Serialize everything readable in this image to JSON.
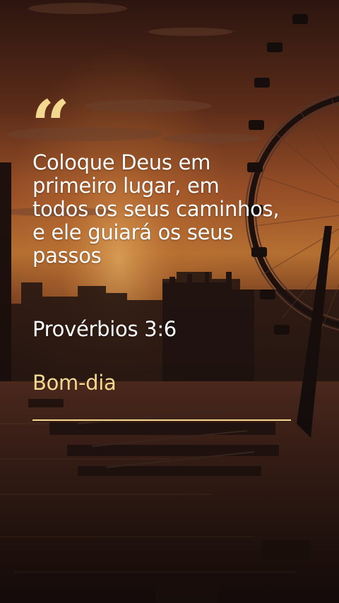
{
  "quote": {
    "mark": "“",
    "lines": [
      "Coloque Deus em",
      "primeiro lugar, em",
      "todos os seus caminhos,",
      "e ele guiará os seus",
      "passos"
    ]
  },
  "reference": "Provérbios 3:6",
  "greeting": "Bom-dia",
  "colors": {
    "accent": "#f2d98f",
    "text": "#ffffff"
  }
}
